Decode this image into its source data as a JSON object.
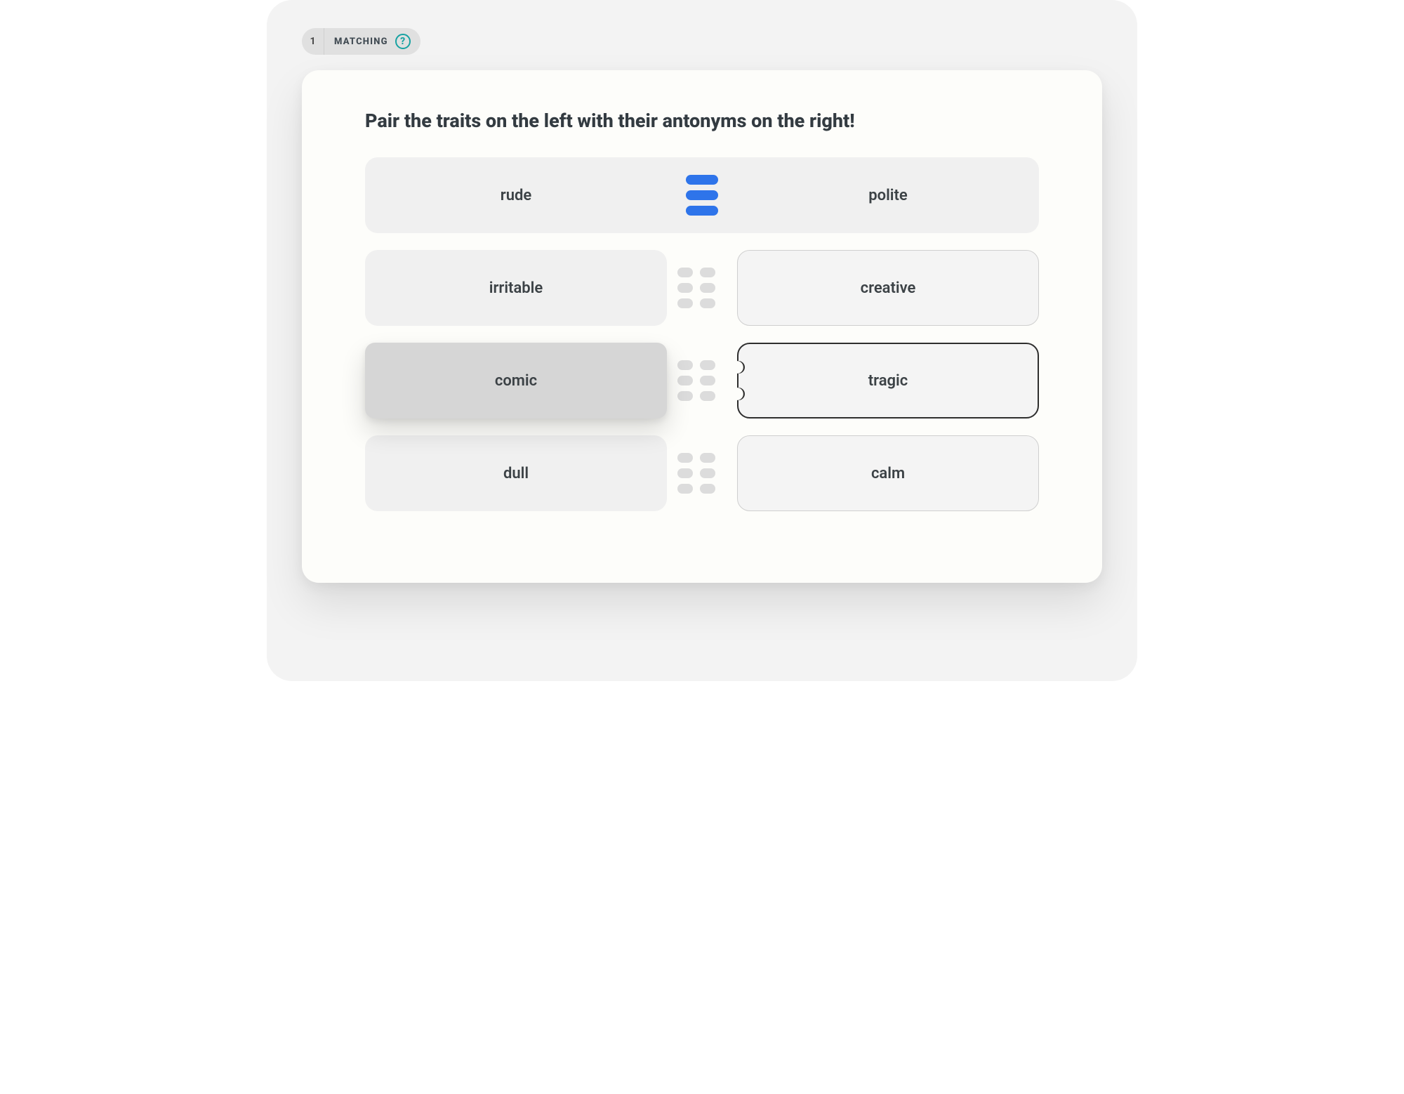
{
  "header": {
    "number": "1",
    "label": "MATCHING",
    "help_glyph": "?"
  },
  "prompt": "Pair the traits on the left with their antonyms on the right!",
  "rows": [
    {
      "left": "rude",
      "right": "polite",
      "state": "matched"
    },
    {
      "left": "irritable",
      "right": "creative",
      "state": "default"
    },
    {
      "left": "comic",
      "right": "tragic",
      "state": "selected"
    },
    {
      "left": "dull",
      "right": "calm",
      "state": "default"
    }
  ],
  "colors": {
    "accent_blue": "#2e74ea",
    "teal": "#17a2a2"
  }
}
